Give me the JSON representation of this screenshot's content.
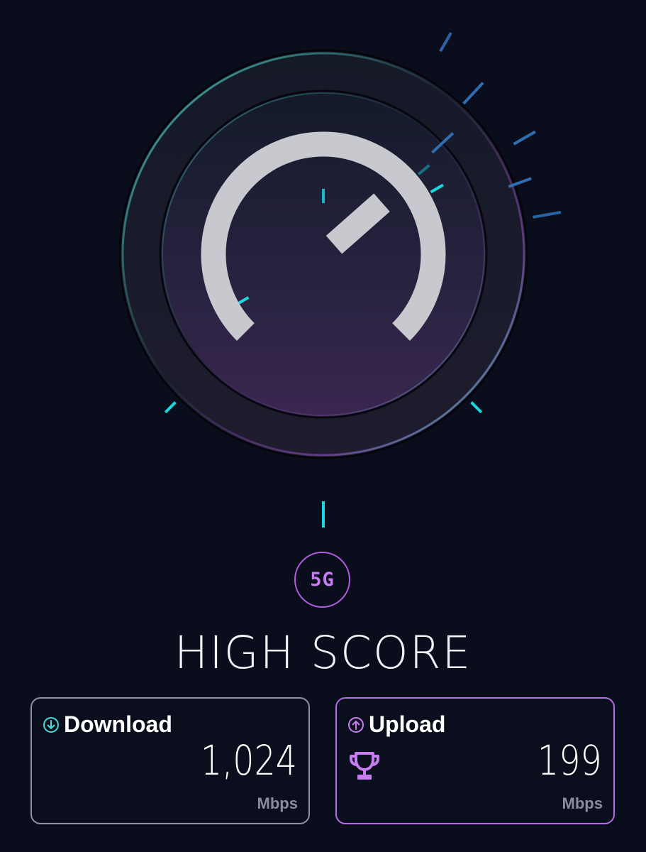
{
  "gauge": {
    "level": 0.68,
    "colors": {
      "arc": "#c8c9cf",
      "tick_cyan": "#1ad7e0",
      "tick_blue": "#2f6eb3",
      "ring_teal": "#4fd3c8",
      "ring_purple": "#6b3f8e"
    }
  },
  "network_badge": {
    "label": "5G",
    "color": "#b45be4"
  },
  "headline": "HIGH SCORE",
  "download": {
    "label": "Download",
    "value": "1,024",
    "unit": "Mbps",
    "icon": "arrow-down-circle-icon",
    "accent": "#4fd8d8"
  },
  "upload": {
    "label": "Upload",
    "value": "199",
    "unit": "Mbps",
    "icon": "arrow-up-circle-icon",
    "badge_icon": "trophy-icon",
    "accent": "#b56ce6"
  }
}
